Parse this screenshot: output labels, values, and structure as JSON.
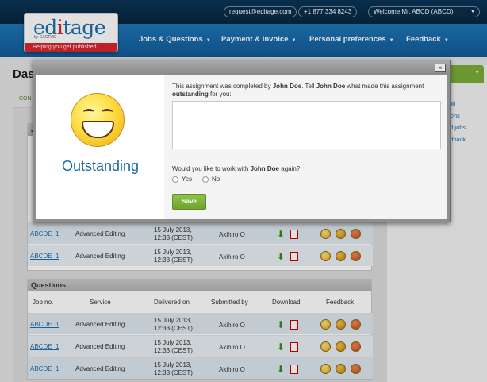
{
  "header": {
    "email": "request@editage.com",
    "phone": "+1 877 334 8243",
    "welcome": "Welcome Mr. ABCD (ABCD)",
    "logo_text": "editage",
    "logo_by": "by CACTUS",
    "logo_tagline": "Helping you get published",
    "nav": [
      {
        "label": "Jobs & Questions"
      },
      {
        "label": "Payment & Invoice"
      },
      {
        "label": "Personal preferences"
      },
      {
        "label": "Feedback"
      }
    ]
  },
  "page": {
    "title": "Das",
    "link_partial": "CON",
    "right_links": [
      "ob",
      "ions",
      "ed jobs",
      "edback"
    ]
  },
  "jobs_section": {
    "title_partial": "J",
    "rows": [
      {
        "job": "ABCDE_1",
        "service": "Advanced Editing",
        "delivered": "15 July 2013,",
        "delivered_time": "12:33 (CEST)",
        "by": "Akihiro O"
      },
      {
        "job": "ABCDE_1",
        "service": "Advanced Editing",
        "delivered": "15 July 2013,",
        "delivered_time": "12:33 (CEST)",
        "by": "Akihiro O"
      }
    ]
  },
  "questions": {
    "title": "Questions",
    "headers": [
      "Job no.",
      "Service",
      "Delivered on",
      "Submitted by",
      "Download",
      "Feedback"
    ],
    "rows": [
      {
        "job": "ABCDE_1",
        "service": "Advanced Editing",
        "delivered": "15 July 2013,",
        "delivered_time": "12:33 (CEST)",
        "by": "Akihiro O"
      },
      {
        "job": "ABCDE_1",
        "service": "Advanced Editing",
        "delivered": "15 July 2013,",
        "delivered_time": "12:33 (CEST)",
        "by": "Akihiro O"
      },
      {
        "job": "ABCDE_1",
        "service": "Advanced Editing",
        "delivered": "15 July 2013,",
        "delivered_time": "12:33 (CEST)",
        "by": "Akihiro O"
      }
    ]
  },
  "modal": {
    "close": "×",
    "rating_label": "Outstanding",
    "msg_pre": "This assignment was completed by ",
    "editor": "John Doe",
    "msg_mid": ". Tell ",
    "msg_mid2": " what made this assignment ",
    "msg_word": "outstanding",
    "msg_post": " for you:",
    "textarea_value": "",
    "question_pre": "Would you like to work with ",
    "question_post": " again?",
    "yes": "Yes",
    "no": "No",
    "save": "Save"
  },
  "colors": {
    "brand_blue": "#1f6fb0",
    "green": "#7cae3a",
    "red": "#d9262f"
  },
  "icons": [
    "download-icon",
    "pdf-icon",
    "outstanding-smiley-icon",
    "neutral-smiley-icon",
    "unhappy-smiley-icon"
  ]
}
